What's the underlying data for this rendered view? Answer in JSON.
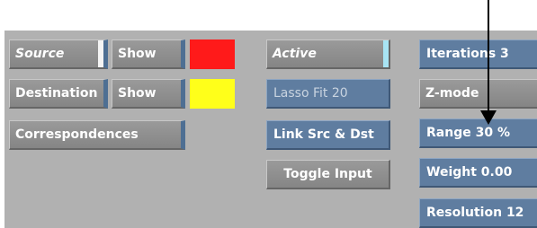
{
  "left_group": {
    "source_label": "Source",
    "source_show_label": "Show",
    "source_color": "#ff1a1a",
    "destination_label": "Destination",
    "destination_show_label": "Show",
    "destination_color": "#ffff1a",
    "correspondences_label": "Correspondences"
  },
  "middle_group": {
    "active_label": "Active",
    "lasso_fit_label": "Lasso Fit 20",
    "link_label": "Link Src & Dst",
    "toggle_input_label": "Toggle Input"
  },
  "right_group": {
    "iterations_label": "Iterations 3",
    "zmode_label": "Z-mode",
    "range_label": "Range 30 %",
    "weight_label": "Weight 0.00",
    "resolution_label": "Resolution 12"
  },
  "icons": {
    "callout": "down-arrow-icon"
  }
}
